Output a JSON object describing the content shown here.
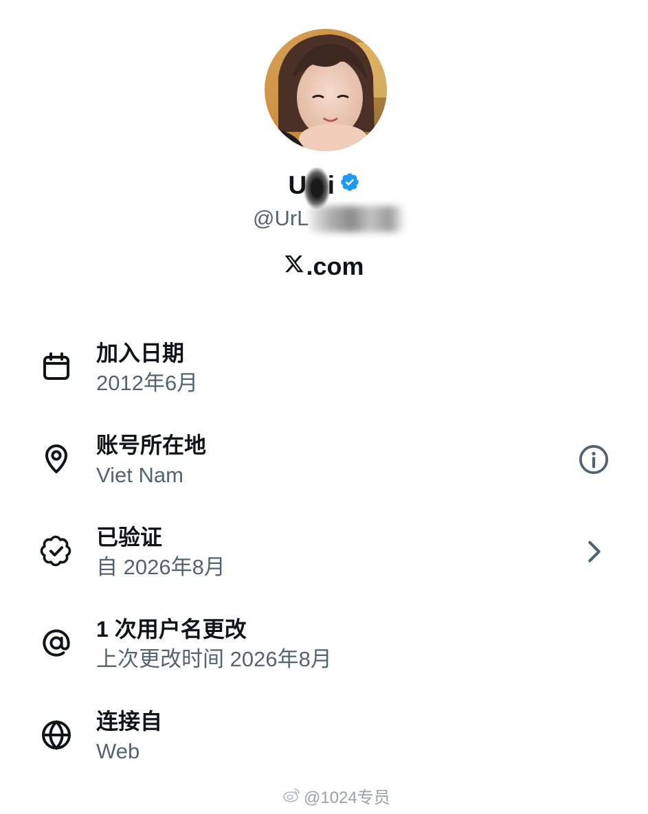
{
  "profile": {
    "display_name": "Ui",
    "display_name_part1": "U",
    "display_name_part2": "i",
    "handle": "@UrL",
    "site": ".com",
    "verified_color": "#1d9bf0"
  },
  "info": [
    {
      "icon": "calendar-icon",
      "title": "加入日期",
      "subtitle": "2012年6月"
    },
    {
      "icon": "location-pin-icon",
      "title": "账号所在地",
      "subtitle": "Viet Nam",
      "right_icon": "info-icon"
    },
    {
      "icon": "verified-badge-icon",
      "title": "已验证",
      "subtitle": "自 2026年8月",
      "right_icon": "chevron-right-icon"
    },
    {
      "icon": "at-sign-icon",
      "title": "1 次用户名更改",
      "subtitle": "上次更改时间 2026年8月"
    },
    {
      "icon": "globe-icon",
      "title": "连接自",
      "subtitle": "Web"
    }
  ],
  "watermark": {
    "text": "@1024专员"
  },
  "colors": {
    "primary_text": "#0f1419",
    "secondary_text": "#536471",
    "accent": "#1d9bf0"
  }
}
